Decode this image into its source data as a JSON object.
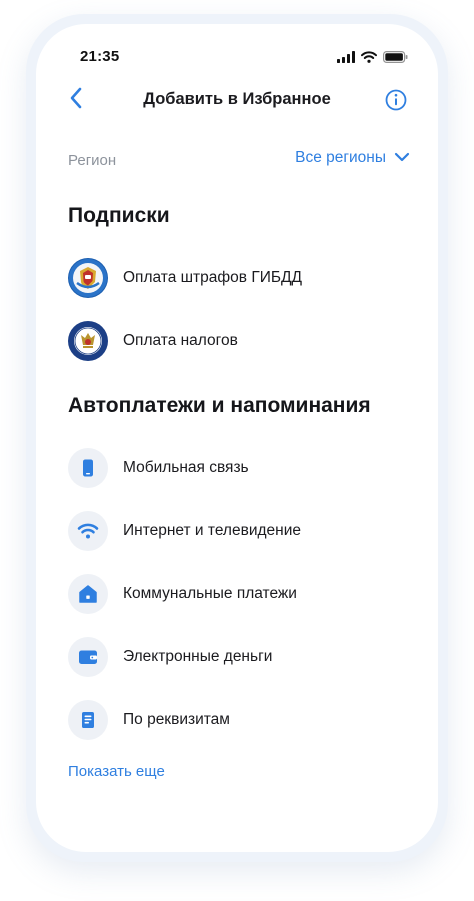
{
  "status_bar": {
    "time": "21:35"
  },
  "header": {
    "title": "Добавить в Избранное"
  },
  "region": {
    "label": "Регион",
    "value": "Все регионы"
  },
  "subscriptions": {
    "title": "Подписки",
    "items": [
      {
        "label": "Оплата штрафов ГИБДД",
        "icon": "gibdd-emblem-icon"
      },
      {
        "label": "Оплата налогов",
        "icon": "tax-service-emblem-icon"
      }
    ]
  },
  "autopayments": {
    "title": "Автоплатежи и напоминания",
    "items": [
      {
        "label": "Мобильная связь",
        "icon": "mobile-phone-icon"
      },
      {
        "label": "Интернет и телевидение",
        "icon": "wifi-icon"
      },
      {
        "label": "Коммунальные платежи",
        "icon": "house-icon"
      },
      {
        "label": "Электронные деньги",
        "icon": "wallet-icon"
      },
      {
        "label": "По реквизитам",
        "icon": "document-icon"
      }
    ]
  },
  "show_more": "Показать еще",
  "colors": {
    "accent": "#2f7fe0",
    "icon_background": "#eef1f6",
    "muted_text": "#8d939c"
  }
}
